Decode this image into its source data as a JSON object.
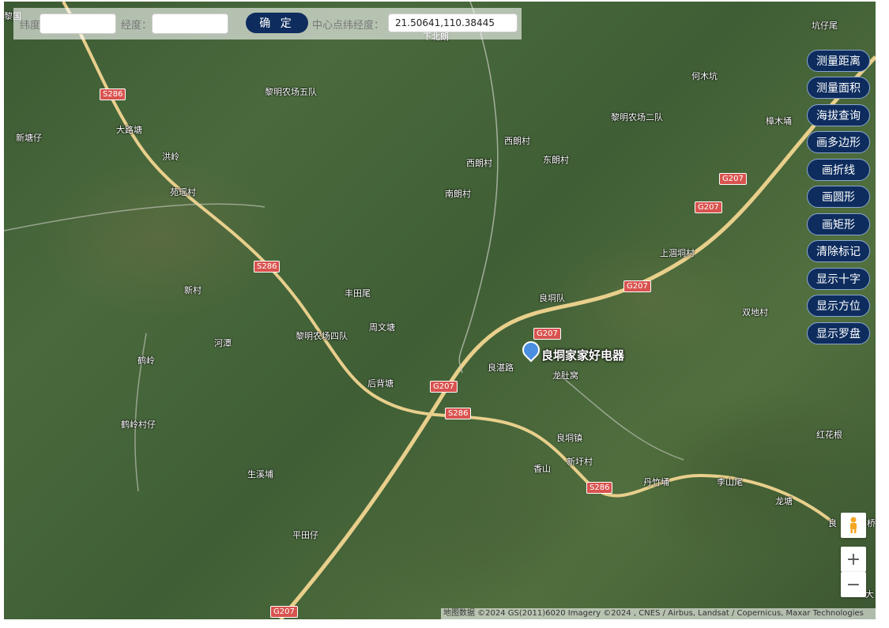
{
  "toolbar": {
    "lat_label": "纬度：",
    "lat_value": "",
    "lng_label": "经度：",
    "lng_value": "",
    "confirm_label": "确 定",
    "center_label": "中心点纬经度：",
    "center_value": "21.50641,110.38445"
  },
  "tools": [
    "测量距离",
    "测量面积",
    "海拔查询",
    "画多边形",
    "画折线",
    "画圆形",
    "画矩形",
    "清除标记",
    "显示十字",
    "显示方位",
    "显示罗盘"
  ],
  "map": {
    "places": [
      "黎明农场五队",
      "黎明农场二队",
      "何木坑",
      "坑仔尾",
      "新塘仔",
      "大路塘",
      "洪岭",
      "苑瑶村",
      "西朗村",
      "西朗村",
      "东朗村",
      "南朗村",
      "樟木埇",
      "上涸垌村",
      "新村",
      "丰田尾",
      "良垌队",
      "双地村",
      "河潭",
      "黎明农场四队",
      "周文塘",
      "鹤岭",
      "后背塘",
      "良湛路",
      "龙肚窝",
      "鹤岭村仔",
      "良垌镇",
      "红花根",
      "生溪埔",
      "香山",
      "新圩村",
      "丹竹埇",
      "李山尾",
      "龙塘",
      "平田仔",
      "良",
      "大",
      "黎国",
      "下北朗",
      "桥"
    ],
    "road_labels": [
      "S286",
      "S286",
      "S286",
      "S286",
      "G207",
      "G207",
      "G207",
      "G207",
      "G207",
      "G207"
    ],
    "poi_label": "良垌家家好电器",
    "attribution": "地图数据 ©2024 GS(2011)6020 Imagery ©2024 , CNES / Airbus, Landsat / Copernicus, Maxar Technologies",
    "zoom_in": "+",
    "zoom_out": "−",
    "colors": {
      "button_bg": "#0e2d5e",
      "road": "#f3d9a0",
      "shield": "#d9534f"
    },
    "icons": [
      "pegman-icon",
      "poi-pin-icon"
    ]
  }
}
